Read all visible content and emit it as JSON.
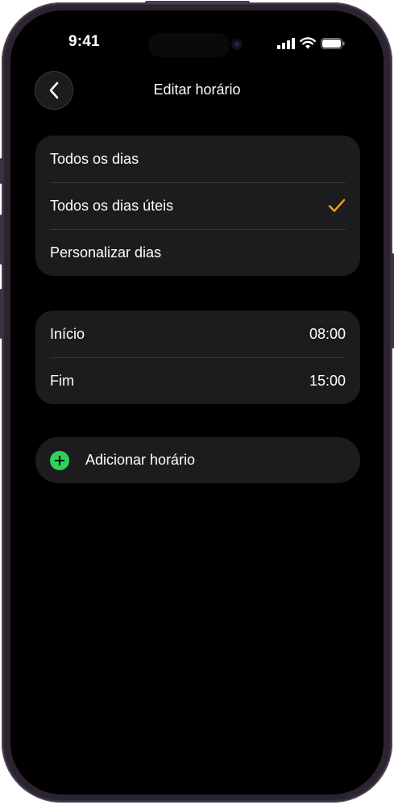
{
  "status_bar": {
    "time": "9:41"
  },
  "header": {
    "title": "Editar horário"
  },
  "repeat_options": [
    {
      "label": "Todos os dias",
      "selected": false
    },
    {
      "label": "Todos os dias úteis",
      "selected": true
    },
    {
      "label": "Personalizar dias",
      "selected": false
    }
  ],
  "schedule": {
    "start_label": "Início",
    "start_value": "08:00",
    "end_label": "Fim",
    "end_value": "15:00"
  },
  "add_schedule": {
    "label": "Adicionar horário"
  },
  "colors": {
    "accent": "#ff9f0a",
    "add_icon": "#30d158",
    "row_bg": "#1c1c1e",
    "background": "#000000"
  },
  "icons": [
    "chevron-left-icon",
    "checkmark-icon",
    "plus-circle-icon",
    "cellular-signal-icon",
    "wifi-icon",
    "battery-icon"
  ]
}
